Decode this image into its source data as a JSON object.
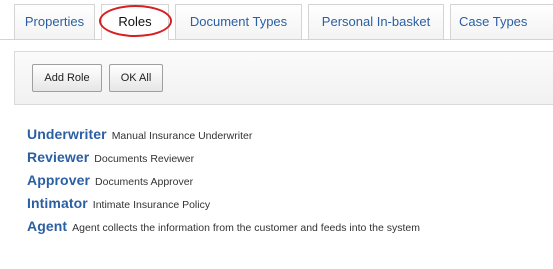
{
  "tabs": [
    {
      "label": "Properties"
    },
    {
      "label": "Roles",
      "active": true
    },
    {
      "label": "Document Types"
    },
    {
      "label": "Personal In-basket"
    },
    {
      "label": "Case Types"
    }
  ],
  "toolbar": {
    "add_role_label": "Add Role",
    "ok_all_label": "OK All"
  },
  "roles": [
    {
      "name": "Underwriter",
      "description": "Manual Insurance Underwriter"
    },
    {
      "name": "Reviewer",
      "description": "Documents Reviewer"
    },
    {
      "name": "Approver",
      "description": "Documents Approver"
    },
    {
      "name": "Intimator",
      "description": "Intimate Insurance Policy"
    },
    {
      "name": "Agent",
      "description": "Agent collects the information from the customer and feeds into the system"
    }
  ],
  "colors": {
    "link": "#2b5fa3",
    "highlight": "#d62020",
    "border": "#d4d4d4"
  }
}
